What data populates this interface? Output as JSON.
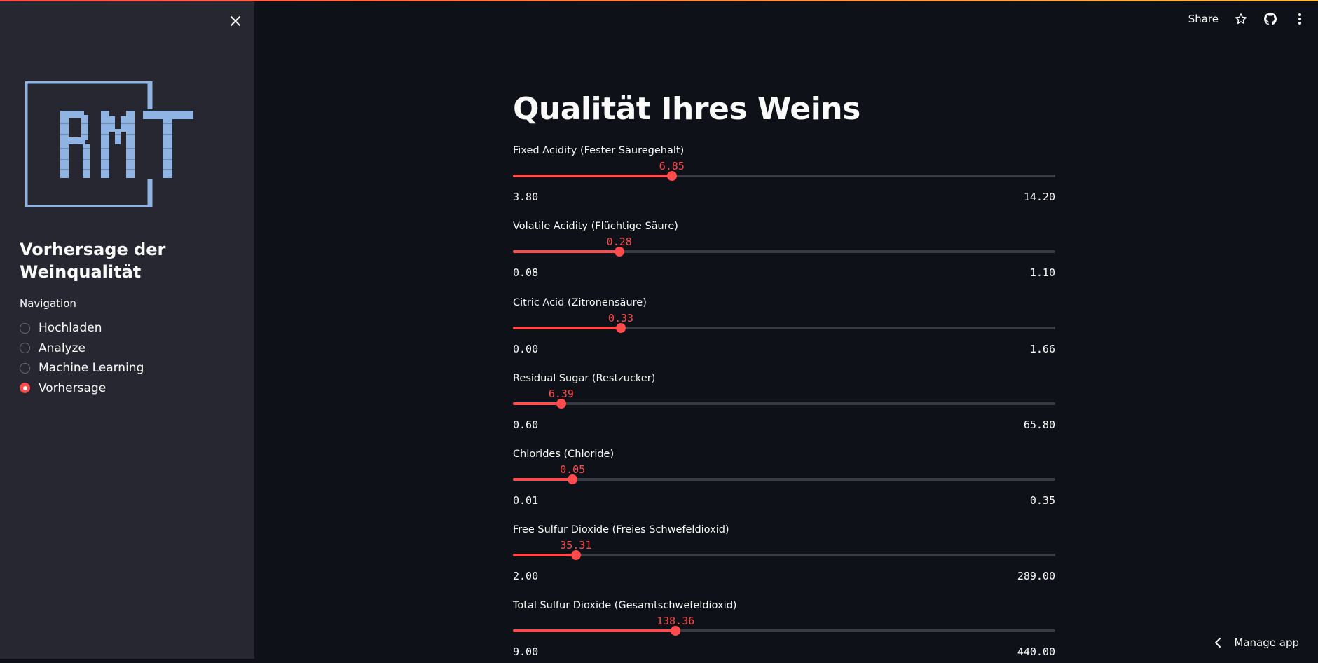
{
  "sidebar": {
    "logo_text": "RMT",
    "title": "Vorhersage der Weinqualität",
    "nav_label": "Navigation",
    "nav_items": [
      {
        "label": "Hochladen",
        "checked": false
      },
      {
        "label": "Analyze",
        "checked": false
      },
      {
        "label": "Machine Learning",
        "checked": false
      },
      {
        "label": "Vorhersage",
        "checked": true
      }
    ]
  },
  "toolbar": {
    "share_label": "Share",
    "icons": [
      "star-icon",
      "github-icon",
      "more-vert-icon"
    ]
  },
  "main": {
    "title": "Qualität Ihres Weins",
    "sliders": [
      {
        "label": "Fixed Acidity (Fester Säuregehalt)",
        "value": "6.85",
        "min": "3.80",
        "max": "14.20",
        "fraction": 0.293
      },
      {
        "label": "Volatile Acidity (Flüchtige Säure)",
        "value": "0.28",
        "min": "0.08",
        "max": "1.10",
        "fraction": 0.196
      },
      {
        "label": "Citric Acid (Zitronensäure)",
        "value": "0.33",
        "min": "0.00",
        "max": "1.66",
        "fraction": 0.199
      },
      {
        "label": "Residual Sugar (Restzucker)",
        "value": "6.39",
        "min": "0.60",
        "max": "65.80",
        "fraction": 0.089
      },
      {
        "label": "Chlorides (Chloride)",
        "value": "0.05",
        "min": "0.01",
        "max": "0.35",
        "fraction": 0.11
      },
      {
        "label": "Free Sulfur Dioxide (Freies Schwefeldioxid)",
        "value": "35.31",
        "min": "2.00",
        "max": "289.00",
        "fraction": 0.116
      },
      {
        "label": "Total Sulfur Dioxide (Gesamtschwefeldioxid)",
        "value": "138.36",
        "min": "9.00",
        "max": "440.00",
        "fraction": 0.3
      }
    ]
  },
  "footer": {
    "manage_label": "Manage app"
  },
  "colors": {
    "accent": "#ff4b4b",
    "sidebar_bg": "#262730",
    "main_bg": "#0e1117",
    "logo": "#8fb4e3"
  }
}
